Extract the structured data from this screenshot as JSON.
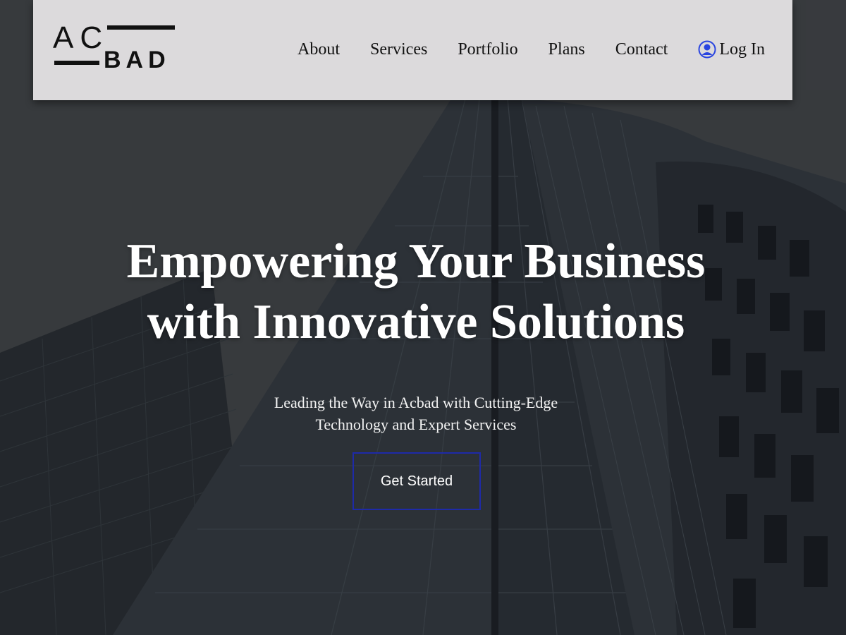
{
  "brand": {
    "logo_top": "AC",
    "logo_bottom": "BAD"
  },
  "nav": {
    "items": [
      {
        "label": "About"
      },
      {
        "label": "Services"
      },
      {
        "label": "Portfolio"
      },
      {
        "label": "Plans"
      },
      {
        "label": "Contact"
      }
    ],
    "login_label": "Log In",
    "login_icon": "user-circle-icon"
  },
  "hero": {
    "title_line1": "Empowering Your Business",
    "title_line2": "with Innovative Solutions",
    "subtitle_line1": "Leading the Way in Acbad with Cutting-Edge",
    "subtitle_line2": "Technology and Expert Services",
    "cta_label": "Get Started",
    "background_image": "skyscrapers-low-angle"
  },
  "colors": {
    "header_bg": "#dcdadc",
    "accent": "#1e2aa8",
    "login_icon": "#2a45e0",
    "hero_text": "#ffffff"
  }
}
